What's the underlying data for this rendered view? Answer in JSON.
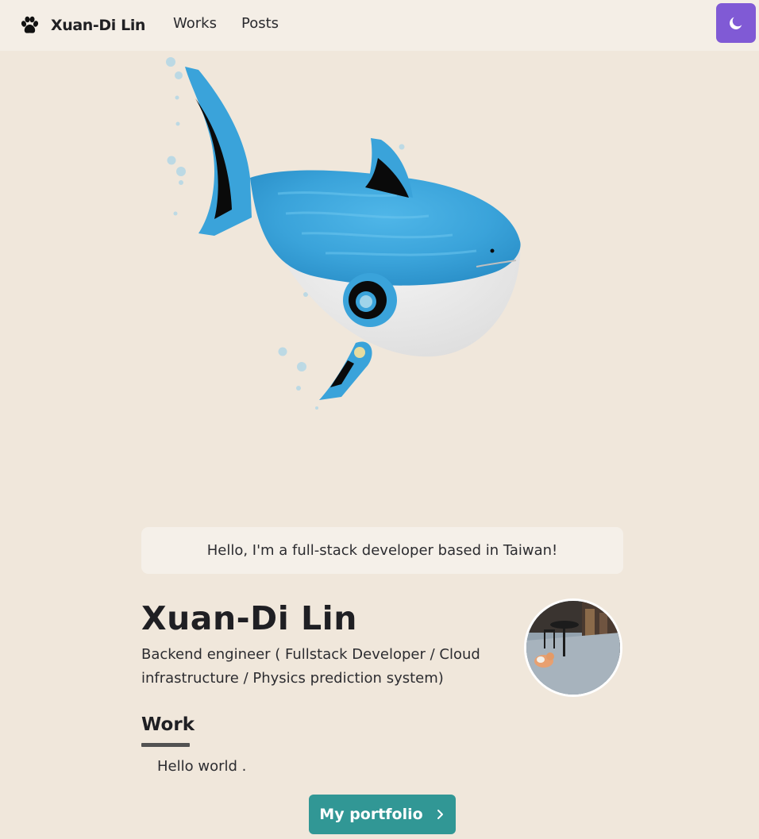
{
  "nav": {
    "brand": "Xuan-Di Lin",
    "links": [
      "Works",
      "Posts"
    ],
    "theme_icon": "moon-icon",
    "brand_icon": "paw-icon"
  },
  "hero": {
    "image": "blue-whale-shark-3d-model"
  },
  "intro": {
    "greeting": "Hello, I'm a full-stack developer based in Taiwan!"
  },
  "profile": {
    "name": "Xuan-Di Lin",
    "role": "Backend engineer ( Fullstack Developer / Cloud infrastructure / Physics prediction system)",
    "avatar": "profile-photo-cat-street"
  },
  "work": {
    "heading": "Work",
    "text": "Hello world .",
    "button_label": "My portfolio",
    "button_icon": "chevron-right-icon"
  },
  "colors": {
    "background": "#f0e7db",
    "navbar": "#f4eee6",
    "theme_button": "#805ad5",
    "portfolio_button": "#319795",
    "shark_blue": "#3fa6dc"
  }
}
